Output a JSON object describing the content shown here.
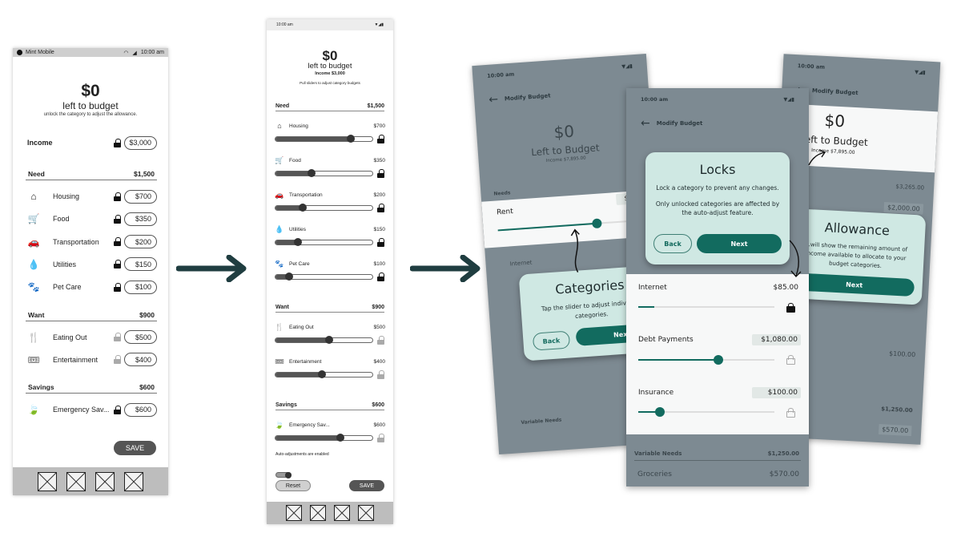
{
  "screen1": {
    "status": {
      "carrier": "Mint Mobile",
      "time": "10:00 am"
    },
    "amount": "$0",
    "subtitle": "left to budget",
    "hint": "unlock the category to adjust the allowance.",
    "income": {
      "label": "Income",
      "value": "$3,000",
      "locked": true
    },
    "sections": [
      {
        "title": "Need",
        "total": "$1,500",
        "items": [
          {
            "icon": "house-icon",
            "glyph": "⌂",
            "label": "Housing",
            "value": "$700",
            "locked": true
          },
          {
            "icon": "cart-icon",
            "glyph": "🛒",
            "label": "Food",
            "value": "$350",
            "locked": true
          },
          {
            "icon": "car-icon",
            "glyph": "🚗",
            "label": "Transportation",
            "value": "$200",
            "locked": true
          },
          {
            "icon": "water-drop-icon",
            "glyph": "💧",
            "label": "Utilities",
            "value": "$150",
            "locked": true
          },
          {
            "icon": "paw-icon",
            "glyph": "🐾",
            "label": "Pet Care",
            "value": "$100",
            "locked": true
          }
        ]
      },
      {
        "title": "Want",
        "total": "$900",
        "items": [
          {
            "icon": "utensils-icon",
            "glyph": "🍴",
            "label": "Eating Out",
            "value": "$500",
            "locked": false
          },
          {
            "icon": "ticket-icon",
            "glyph": "🎟",
            "label": "Entertainment",
            "value": "$400",
            "locked": false
          }
        ]
      },
      {
        "title": "Savings",
        "total": "$600",
        "items": [
          {
            "icon": "leaf-icon",
            "glyph": "🍃",
            "label": "Emergency Sav...",
            "value": "$600",
            "locked": true
          }
        ]
      }
    ],
    "save_label": "SAVE"
  },
  "screen2": {
    "status": {
      "time": "10:00 am"
    },
    "amount": "$0",
    "subtitle": "left to budget",
    "income": "Income $3,000",
    "hint": "Pull sliders to adjust category budgets",
    "sections": [
      {
        "title": "Need",
        "total": "$1,500",
        "items": [
          {
            "icon": "house-icon",
            "glyph": "⌂",
            "label": "Housing",
            "value": "$700",
            "fill": 0.78,
            "locked": true
          },
          {
            "icon": "cart-icon",
            "glyph": "🛒",
            "label": "Food",
            "value": "$350",
            "fill": 0.37,
            "locked": true
          },
          {
            "icon": "car-icon",
            "glyph": "🚗",
            "label": "Transportation",
            "value": "$200",
            "fill": 0.28,
            "locked": true
          },
          {
            "icon": "water-drop-icon",
            "glyph": "💧",
            "label": "Utilities",
            "value": "$150",
            "fill": 0.23,
            "locked": true
          },
          {
            "icon": "paw-icon",
            "glyph": "🐾",
            "label": "Pet Care",
            "value": "$100",
            "fill": 0.14,
            "locked": true
          }
        ]
      },
      {
        "title": "Want",
        "total": "$900",
        "items": [
          {
            "icon": "utensils-icon",
            "glyph": "🍴",
            "label": "Eating Out",
            "value": "$500",
            "fill": 0.55,
            "locked": false
          },
          {
            "icon": "ticket-icon",
            "glyph": "🎟",
            "label": "Entertainment",
            "value": "$400",
            "fill": 0.48,
            "locked": false
          }
        ]
      },
      {
        "title": "Savings",
        "total": "$600",
        "items": [
          {
            "icon": "leaf-icon",
            "glyph": "🍃",
            "label": "Emergency Sav...",
            "value": "$600",
            "fill": 0.67,
            "locked": false
          }
        ]
      }
    ],
    "auto_adjust_label": "Auto-adjustments are enabled",
    "auto_adjust_on": true,
    "reset_label": "Reset",
    "save_label": "SAVE"
  },
  "hifi": {
    "time": "10:00 am",
    "appbar_title": "Modify Budget",
    "amount": "$0",
    "subtitle": "Left to Budget",
    "income": "Income $7,895.00",
    "needs_label": "Needs",
    "needs_total": "$3,265.00",
    "rent": {
      "label": "Rent",
      "value": "$2,000.00",
      "fill": 0.62
    },
    "internet": {
      "label": "Internet",
      "value": "$85.00",
      "fill": 0.12,
      "locked": true
    },
    "debt": {
      "label": "Debt Payments",
      "value": "$1,080.00",
      "fill": 0.59,
      "locked": false
    },
    "insurance": {
      "label": "Insurance",
      "value": "$100.00",
      "fill": 0.16,
      "locked": false
    },
    "variable_needs": {
      "label": "Variable Needs",
      "total": "$1,250.00"
    },
    "groceries": {
      "label": "Groceries",
      "value": "$570.00"
    },
    "tip_categories": {
      "title": "Categories",
      "body": "Tap the slider to adjust individual categories.",
      "back": "Back",
      "next": "Next"
    },
    "tip_locks": {
      "title": "Locks",
      "body1": "Lock a category to prevent any changes.",
      "body2": "Only unlocked categories are affected by the auto-adjust feature.",
      "back": "Back",
      "next": "Next"
    },
    "tip_allowance": {
      "title": "Allowance",
      "body": "...will show the remaining amount of income available to allocate to your budget categories.",
      "next": "Next"
    }
  },
  "colors": {
    "accent": "#126b5f",
    "tooltip_bg": "#cfe8e3",
    "dim_overlay": "#7d8a92",
    "arrow": "#1f3d40"
  }
}
